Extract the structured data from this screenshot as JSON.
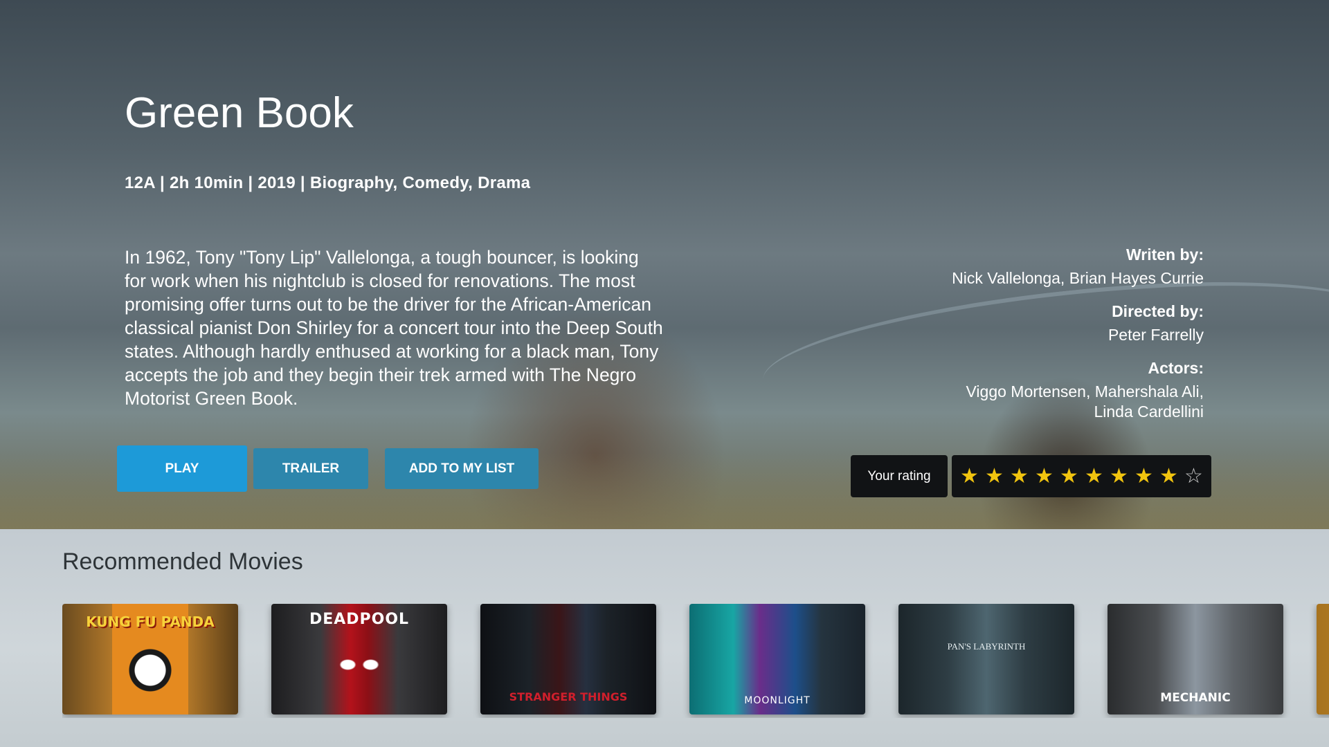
{
  "movie": {
    "title": "Green Book",
    "meta": "12A | 2h 10min | 2019 | Biography, Comedy, Drama",
    "description": "In 1962, Tony \"Tony Lip\" Vallelonga, a tough bouncer, is looking for work when his nightclub is closed for renovations. The most promising offer turns out to be the driver for the African-American classical pianist Don Shirley for a concert tour into the Deep South states. Although hardly enthused at working for a black man, Tony accepts the job and they begin their trek armed with The Negro Motorist Green Book."
  },
  "credits": {
    "writer_label": "Writen by:",
    "writer_value": "Nick Vallelonga, Brian Hayes Currie",
    "director_label": "Directed by:",
    "director_value": "Peter Farrelly",
    "actors_label": "Actors:",
    "actors_value": "Viggo Mortensen, Mahershala Ali, Linda Cardellini"
  },
  "buttons": {
    "play": "PLAY",
    "trailer": "TRAILER",
    "add_to_list": "ADD TO MY LIST"
  },
  "rating": {
    "label": "Your rating",
    "value": 9,
    "max": 10,
    "star_color": "#f1c40f"
  },
  "recommended": {
    "title": "Recommended Movies",
    "posters": [
      {
        "title": "KUNG FU PANDA"
      },
      {
        "title": "DEADPOOL"
      },
      {
        "title": "STRANGER THINGS"
      },
      {
        "title": "MOONLIGHT"
      },
      {
        "title": "PAN'S LABYRINTH"
      },
      {
        "title": "MECHANIC"
      },
      {
        "title": ""
      }
    ]
  },
  "colors": {
    "primary_button": "#1d9ad8",
    "secondary_button": "#2d86ac"
  }
}
